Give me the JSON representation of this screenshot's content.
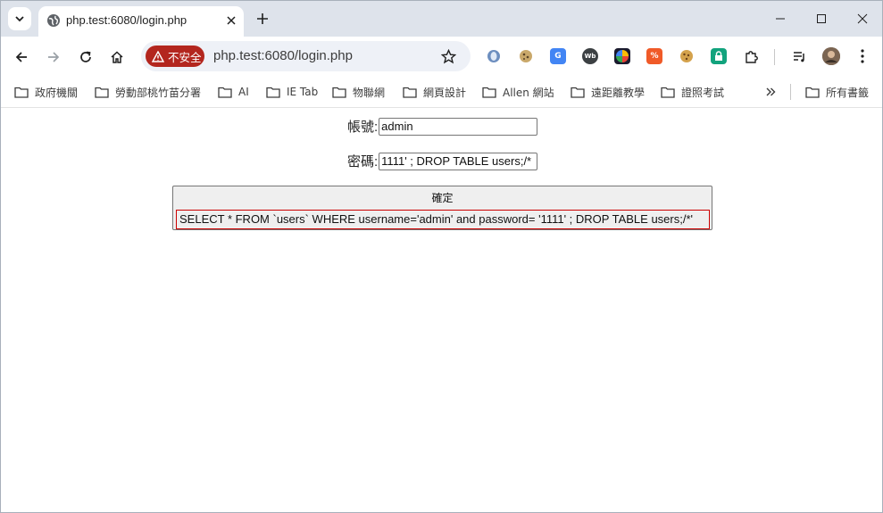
{
  "browser": {
    "tab_title": "php.test:6080/login.php",
    "security_label": "不安全",
    "url": "php.test:6080/login.php",
    "bookmarks": [
      "政府機關",
      "勞動部桃竹苗分署",
      "AI",
      "IE Tab",
      "物聯網",
      "網頁設計",
      "Allen 網站",
      "遠距離教學",
      "證照考試"
    ],
    "all_bookmarks_label": "所有書籤",
    "colors": {
      "tabstrip": "#dee3eb",
      "omnibox": "#eef1f7",
      "not_secure": "#b3261e"
    },
    "extensions": [
      "ie-tab-icon",
      "cookie-ext-icon",
      "google-translate-icon",
      "web-ext-icon",
      "color-picker-icon",
      "code-ext-icon",
      "cookie-icon",
      "password-lock-icon",
      "puzzle-extensions-icon"
    ]
  },
  "form": {
    "username_label": "帳號:",
    "username_value": "admin",
    "password_label": "密碼:",
    "password_value": "1111' ; DROP TABLE users;/*",
    "submit_label": "確定",
    "sql_output": "SELECT * FROM `users` WHERE username='admin' and password= '1111' ; DROP TABLE users;/*'"
  }
}
